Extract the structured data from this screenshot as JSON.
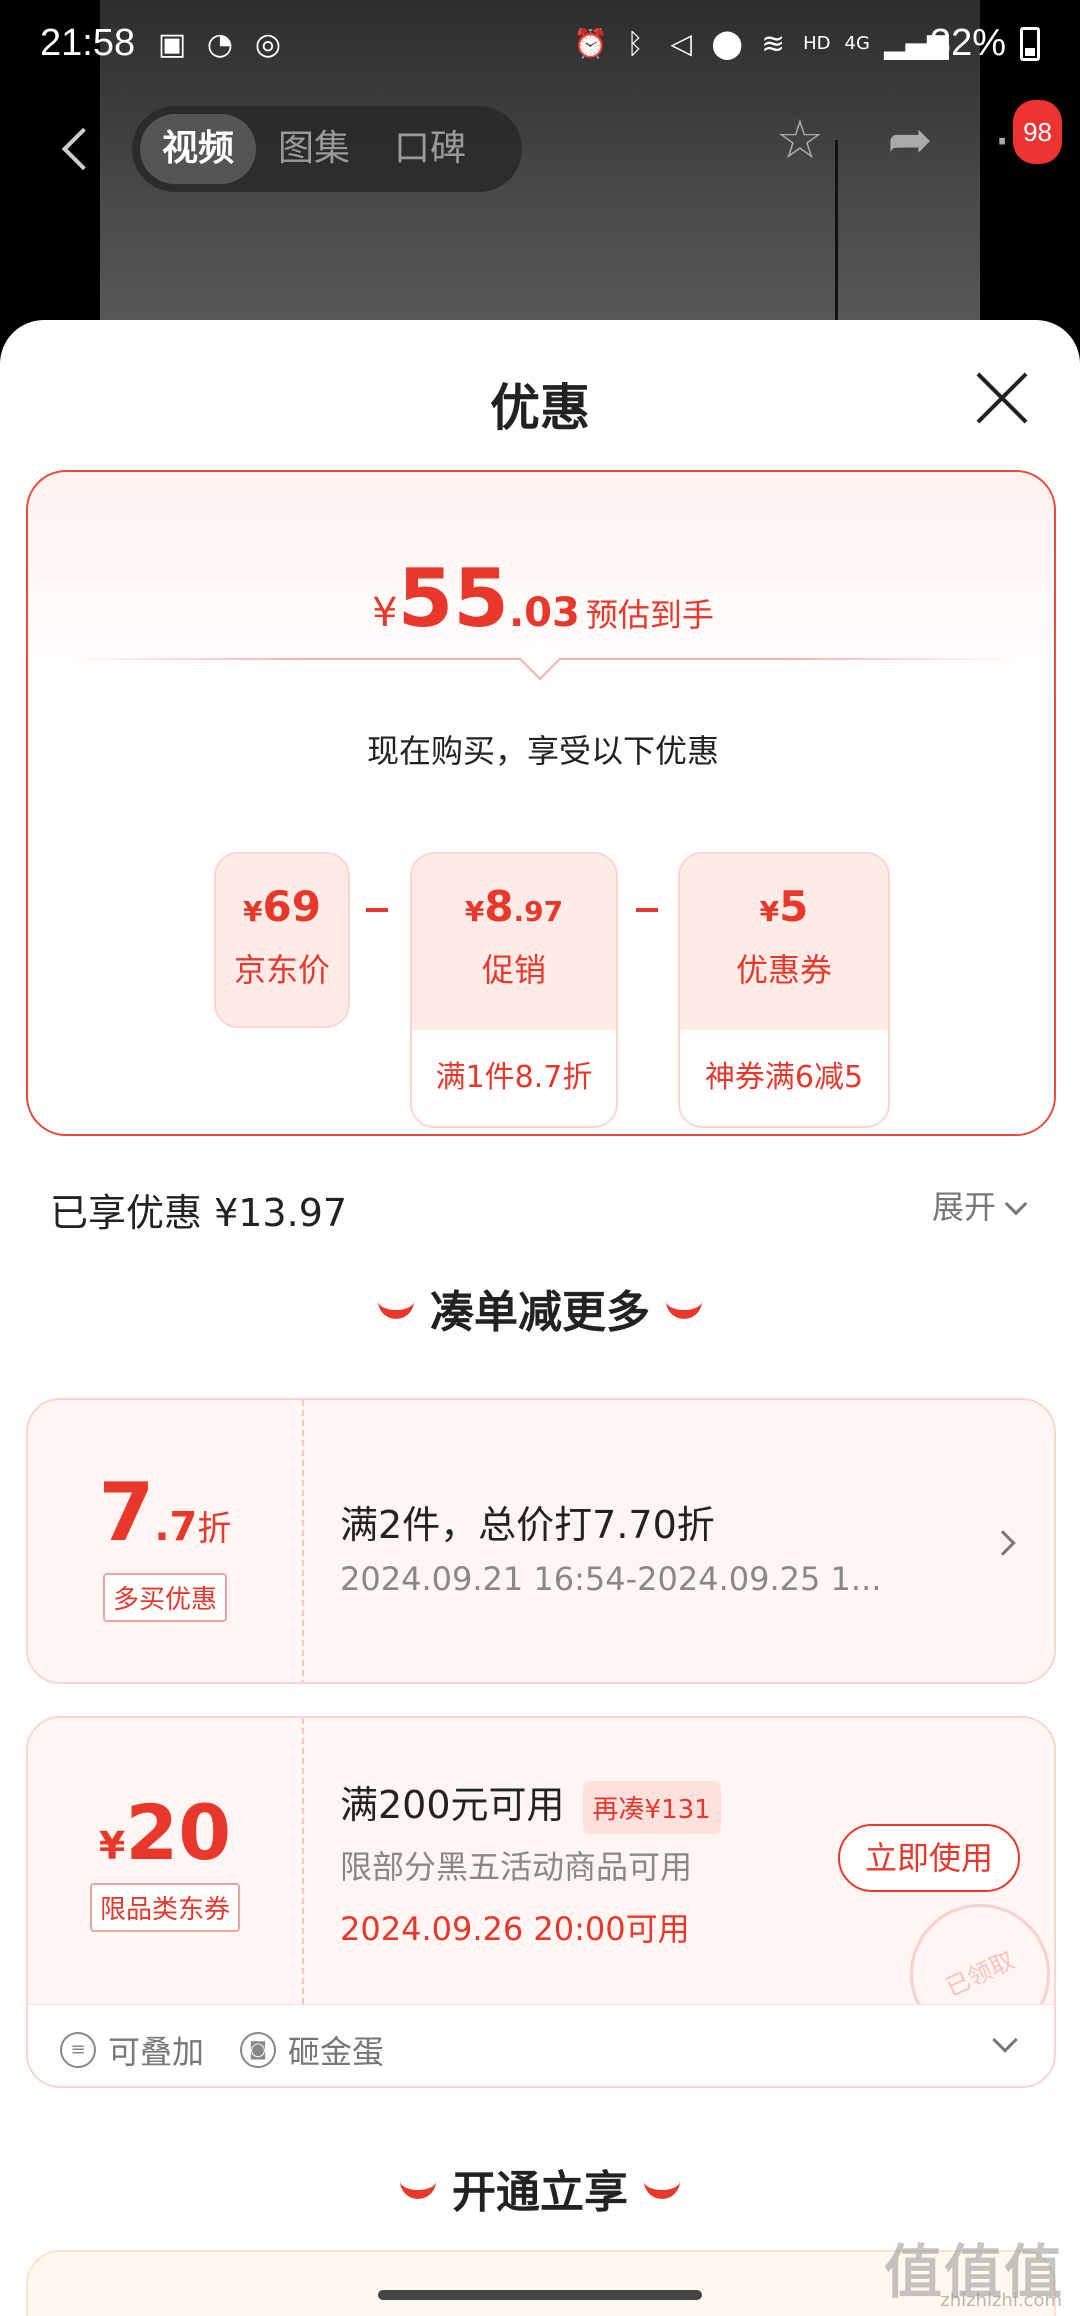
{
  "status": {
    "time": "21:58",
    "battery": "32%",
    "net_label": "HD",
    "cell_label": "4G"
  },
  "nav": {
    "tabs": [
      {
        "label": "视频",
        "active": true
      },
      {
        "label": "图集",
        "active": false
      },
      {
        "label": "口碑",
        "active": false
      }
    ],
    "message_count": "98"
  },
  "sheet": {
    "title": "优惠",
    "estimate": {
      "yen": "¥",
      "int": "55",
      "dec": ".03",
      "label": "预估到手"
    },
    "buy_now_text": "现在购买，享受以下优惠",
    "calc": [
      {
        "value": "69",
        "label": "京东价",
        "detail": ""
      },
      {
        "value_int": "8",
        "value_dec": ".97",
        "label": "促销",
        "detail": "满1件8.7折"
      },
      {
        "value": "5",
        "label": "优惠券",
        "detail": "神券满6减5"
      }
    ],
    "enjoyed": "已享优惠 ¥13.97",
    "expand_label": "展开",
    "section1": "凑单减更多",
    "section2": "开通立享"
  },
  "coupons": [
    {
      "discount_int": "7",
      "discount_dec": ".7",
      "discount_unit": "折",
      "tag": "多买优惠",
      "title": "满2件，总价打7.70折",
      "date": "2024.09.21 16:54-2024.09.25 1..."
    },
    {
      "yen": "¥",
      "amount": "20",
      "tag": "限品类东券",
      "title": "满200元可用",
      "need_more": "再凑¥131",
      "sub": "限部分黑五活动商品可用",
      "date": "2024.09.26 20:00可用",
      "button": "立即使用",
      "stamp": "已领取",
      "footer_stack": "可叠加",
      "footer_egg": "砸金蛋"
    }
  ],
  "watermark": {
    "main": "值值值",
    "sub": "zhizhizhi.com"
  },
  "colors": {
    "accent": "#e8382b",
    "card_bg": "#fff5f3"
  }
}
